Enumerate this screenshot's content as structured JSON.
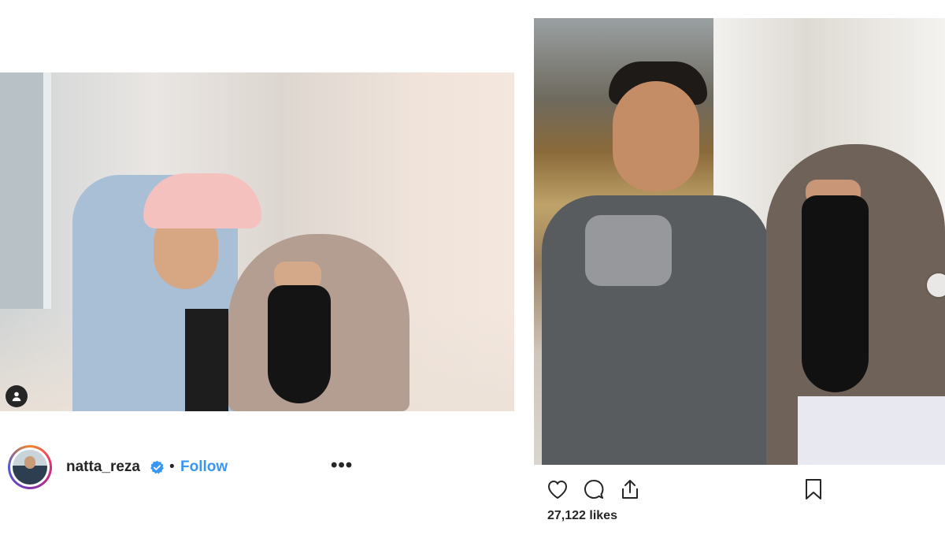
{
  "left_post": {
    "header": {
      "username": "natta_reza",
      "separator": "•",
      "follow_label": "Follow",
      "more_label": "•••"
    },
    "icons": {
      "user_tag": "user-tag-icon",
      "verified": "verified-badge-icon"
    }
  },
  "right_post": {
    "likes_text": "27,122 likes",
    "actions": [
      "like-icon",
      "comment-icon",
      "share-icon",
      "save-icon"
    ]
  },
  "colors": {
    "follow": "#3897f0",
    "text": "#262626",
    "verified": "#3897f0"
  }
}
